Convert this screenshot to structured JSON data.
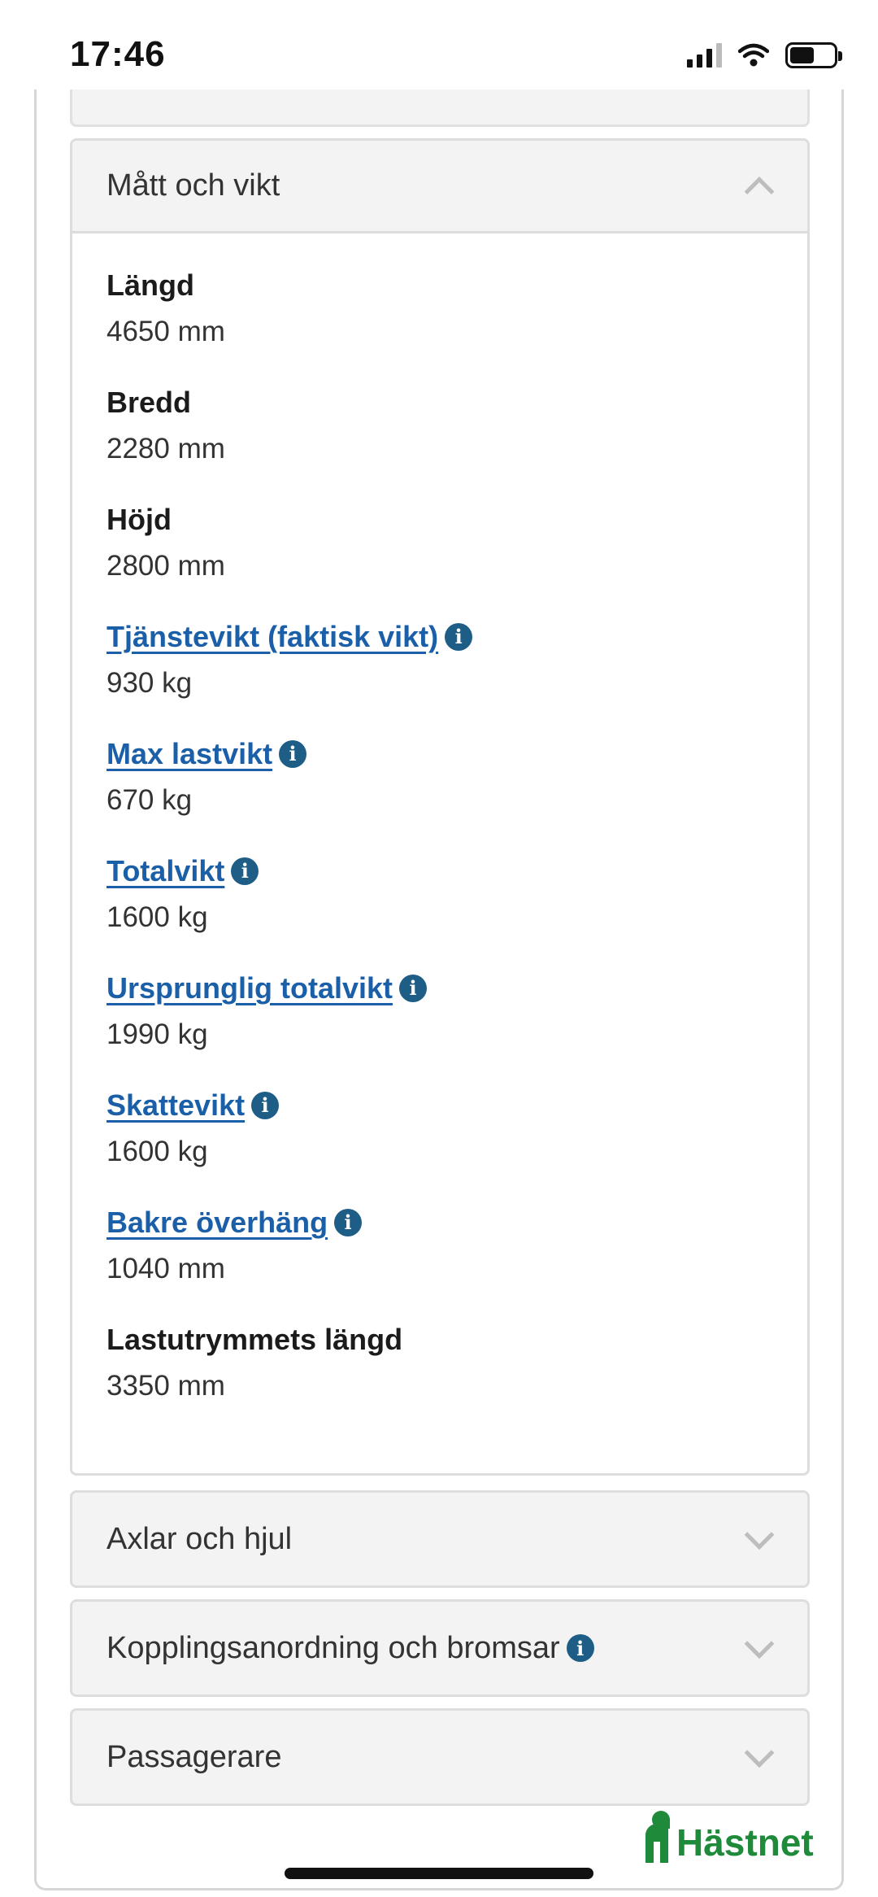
{
  "status_bar": {
    "time": "17:46",
    "signal_icon": "cellular-signal-icon",
    "wifi_icon": "wifi-icon",
    "battery_icon": "battery-icon"
  },
  "sections": {
    "dimensions": {
      "title": "Mått och vikt",
      "expanded": true,
      "fields": [
        {
          "label": "Längd",
          "value": "4650 mm",
          "is_link": false,
          "has_info": false
        },
        {
          "label": "Bredd",
          "value": "2280 mm",
          "is_link": false,
          "has_info": false
        },
        {
          "label": "Höjd",
          "value": "2800 mm",
          "is_link": false,
          "has_info": false
        },
        {
          "label": "Tjänstevikt (faktisk vikt)",
          "value": "930 kg",
          "is_link": true,
          "has_info": true
        },
        {
          "label": "Max lastvikt",
          "value": "670 kg",
          "is_link": true,
          "has_info": true
        },
        {
          "label": "Totalvikt",
          "value": "1600 kg",
          "is_link": true,
          "has_info": true
        },
        {
          "label": "Ursprunglig totalvikt",
          "value": "1990 kg",
          "is_link": true,
          "has_info": true
        },
        {
          "label": "Skattevikt",
          "value": "1600 kg",
          "is_link": true,
          "has_info": true
        },
        {
          "label": "Bakre överhäng",
          "value": "1040 mm",
          "is_link": true,
          "has_info": true
        },
        {
          "label": "Lastutrymmets längd",
          "value": "3350 mm",
          "is_link": false,
          "has_info": false
        }
      ]
    },
    "axles": {
      "title": "Axlar och hjul",
      "expanded": false
    },
    "coupling": {
      "title": "Kopplingsanordning och bromsar",
      "expanded": false,
      "has_info": true
    },
    "passengers": {
      "title": "Passagerare",
      "expanded": false
    }
  },
  "logo": {
    "text": "Hästnet",
    "icon": "horse-head-logo-icon"
  },
  "colors": {
    "link": "#1b5fa8",
    "info_icon": "#1e5d86",
    "brand_green": "#1f8a3a",
    "accordion_bg": "#f3f3f3",
    "border": "#dddddd"
  }
}
